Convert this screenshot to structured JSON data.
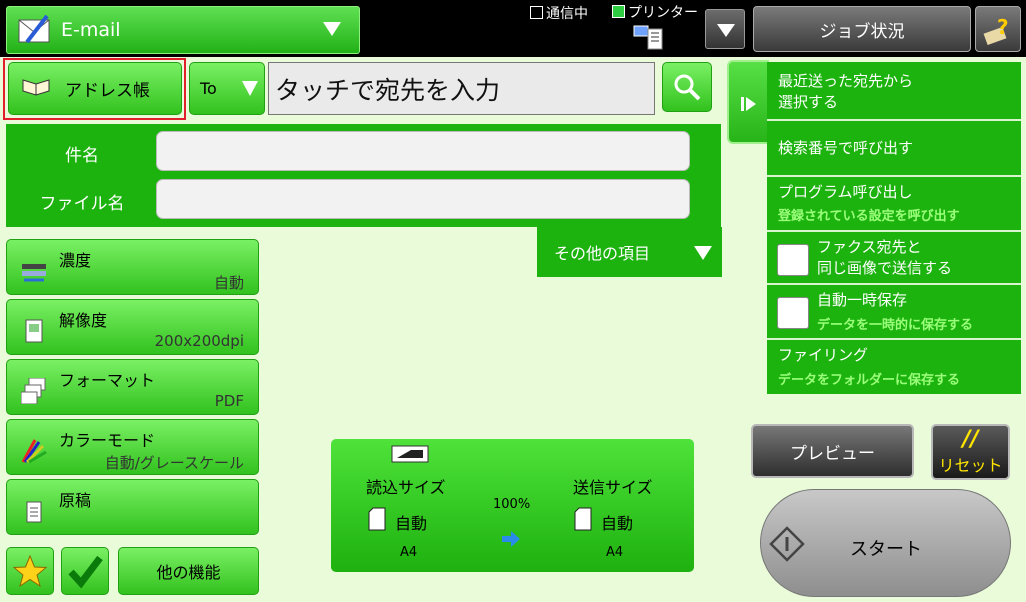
{
  "header": {
    "mode_label": "E-mail",
    "status_comm": "通信中",
    "status_printer": "プリンター",
    "job_status": "ジョブ状況"
  },
  "address": {
    "address_book": "アドレス帳",
    "to_label": "To",
    "destination_text": "タッチで宛先を入力"
  },
  "form": {
    "subject_label": "件名",
    "subject_value": "",
    "filename_label": "ファイル名",
    "filename_value": "",
    "other_items": "その他の項目"
  },
  "settings": [
    {
      "label": "濃度",
      "value": "自動",
      "icon": "density-icon"
    },
    {
      "label": "解像度",
      "value": "200x200dpi",
      "icon": "resolution-icon"
    },
    {
      "label": "フォーマット",
      "value": "PDF",
      "icon": "format-icon"
    },
    {
      "label": "カラーモード",
      "value": "自動/グレースケール",
      "icon": "color-mode-icon"
    },
    {
      "label": "原稿",
      "value": "",
      "icon": "original-icon"
    }
  ],
  "bottom_left": {
    "other_functions": "他の機能"
  },
  "scan": {
    "scan_size_label": "読込サイズ",
    "scan_size_value": "自動",
    "scan_paper": "A4",
    "ratio": "100%",
    "send_size_label": "送信サイズ",
    "send_size_value": "自動",
    "send_paper": "A4"
  },
  "side_panel": {
    "recent": "最近送った宛先から\n選択する",
    "search_number": "検索番号で呼び出す",
    "program_title": "プログラム呼び出し",
    "program_sub": "登録されている設定を呼び出す",
    "fax_same_title": "ファクス宛先と\n同じ画像で送信する",
    "auto_hold_title": "自動一時保存",
    "auto_hold_sub": "データを一時的に保存する",
    "filing_title": "ファイリング",
    "filing_sub": "データをフォルダーに保存する"
  },
  "actions": {
    "preview": "プレビュー",
    "reset": "リセット",
    "start": "スタート"
  },
  "colors": {
    "accent_green": "#1db30f",
    "button_green": "#4ed93a",
    "background": "#e9fbd9",
    "highlight_red": "#e0202a"
  }
}
